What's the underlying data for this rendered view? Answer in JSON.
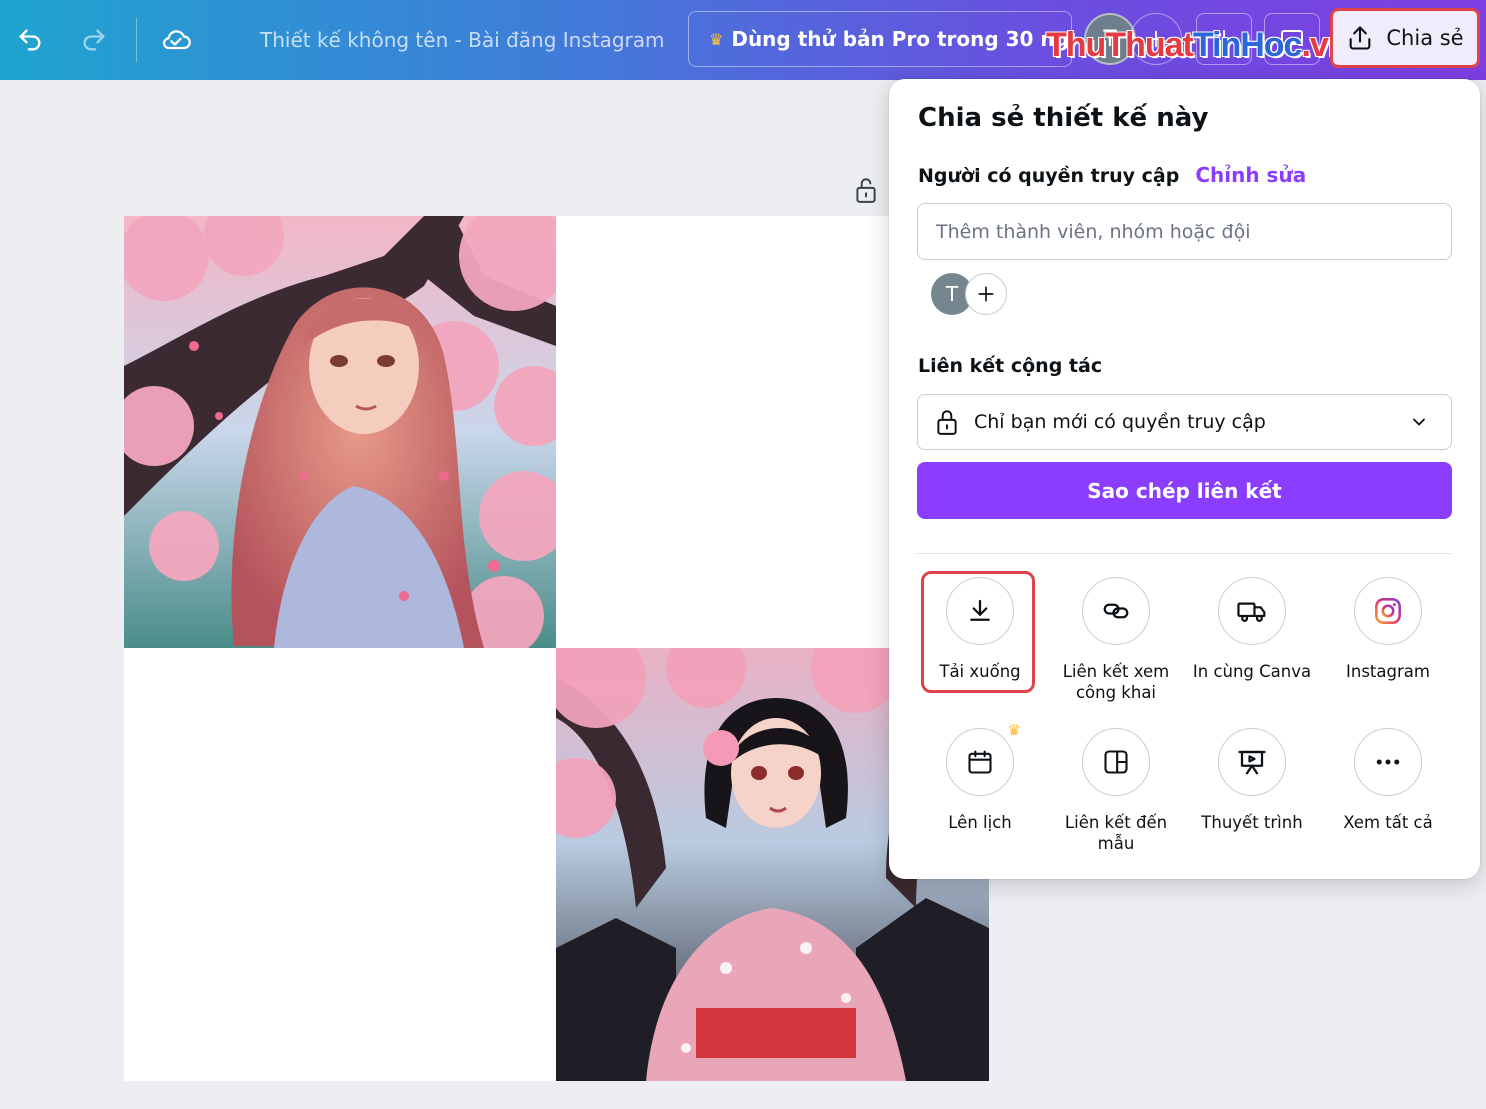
{
  "topbar": {
    "doc_title": "Thiết kế không tên - Bài đăng Instagram",
    "pro_trial_label": "Dùng thử bản Pro trong 30 ngày",
    "avatar_letter": "T",
    "share_label": "Chia sẻ",
    "watermark_part1": "ThuThuat",
    "watermark_part2": "TinHoc",
    "watermark_part3": ".vn"
  },
  "panel": {
    "title": "Chia sẻ thiết kế này",
    "access_label": "Người có quyền truy cập",
    "edit_link": "Chỉnh sửa",
    "member_placeholder": "Thêm thành viên, nhóm hoặc đội",
    "member_avatar_letter": "T",
    "collab_label": "Liên kết cộng tác",
    "collab_value": "Chỉ bạn mới có quyền truy cập",
    "copy_link_label": "Sao chép liên kết",
    "actions": [
      {
        "label": "Tải xuống",
        "icon": "download-icon"
      },
      {
        "label": "Liên kết xem công khai",
        "icon": "link-icon"
      },
      {
        "label": "In cùng Canva",
        "icon": "truck-icon"
      },
      {
        "label": "Instagram",
        "icon": "instagram-icon"
      },
      {
        "label": "Lên lịch",
        "icon": "calendar-icon"
      },
      {
        "label": "Liên kết đến mẫu",
        "icon": "template-icon"
      },
      {
        "label": "Thuyết trình",
        "icon": "presentation-icon"
      },
      {
        "label": "Xem tất cả",
        "icon": "more-icon"
      }
    ]
  },
  "colors": {
    "accent": "#8b3dff",
    "highlight": "#e0434a",
    "crown": "#ffc33d"
  }
}
